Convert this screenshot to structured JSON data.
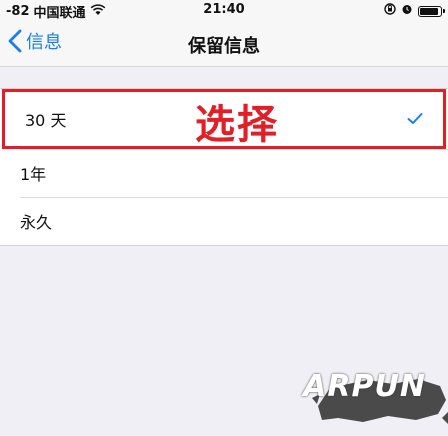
{
  "status_bar": {
    "signal": "-82",
    "carrier": "中国联通",
    "time": "21:40"
  },
  "nav": {
    "back_label": "信息",
    "title": "保留信息"
  },
  "options": [
    {
      "label": "30 天",
      "selected": true
    },
    {
      "label": "1年",
      "selected": false
    },
    {
      "label": "永久",
      "selected": false
    }
  ],
  "annotation": "选择",
  "watermark": "ARPUN",
  "colors": {
    "accent": "#1a7cf5",
    "highlight": "#e21f26"
  }
}
